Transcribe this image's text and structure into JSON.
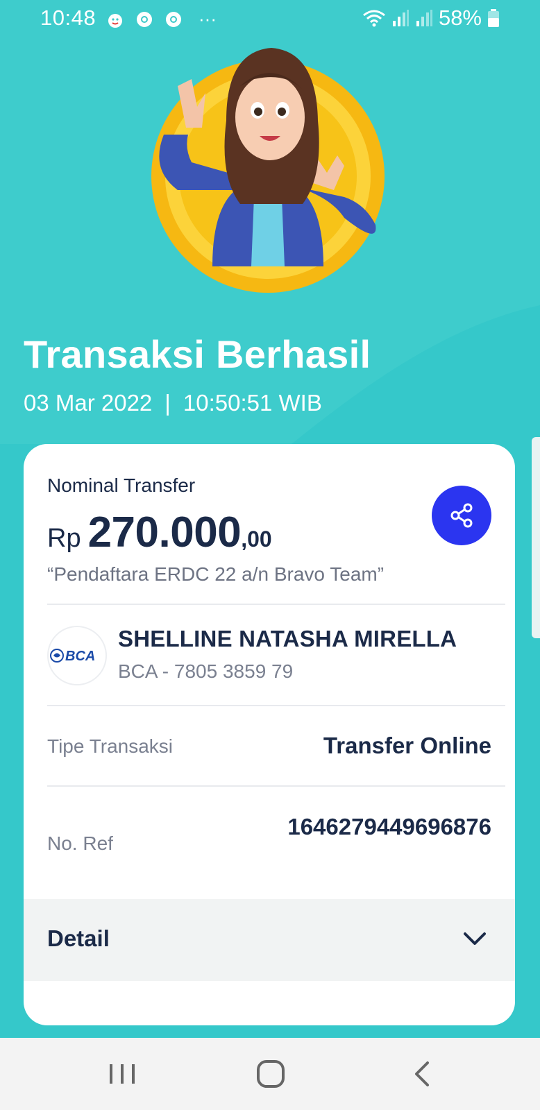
{
  "status_bar": {
    "time": "10:48",
    "more": "···",
    "battery": "58%"
  },
  "page": {
    "title": "Transaksi Berhasil",
    "date": "03 Mar 2022",
    "separator": "|",
    "time": "10:50:51 WIB"
  },
  "transfer": {
    "nominal_label": "Nominal Transfer",
    "currency": "Rp",
    "amount": "270.000",
    "cents": ",00",
    "note": "“Pendaftara ERDC 22 a/n Bravo Team”"
  },
  "recipient": {
    "bank_logo_text": "BCA",
    "name": "SHELLINE NATASHA MIRELLA",
    "account": "BCA - 7805 3859 79"
  },
  "details": {
    "type_label": "Tipe Transaksi",
    "type_value": "Transfer Online",
    "ref_label": "No. Ref",
    "ref_value": "1646279449696876",
    "detail_label": "Detail"
  },
  "colors": {
    "background": "#3cc9c9",
    "accent": "#2b35f0",
    "text_dark": "#1b2a48",
    "coin": "#f7c318"
  },
  "icons": {
    "share": "share-icon",
    "chevron": "chevron-down-icon",
    "nav_recent": "recent-apps-icon",
    "nav_home": "home-icon",
    "nav_back": "back-icon"
  }
}
